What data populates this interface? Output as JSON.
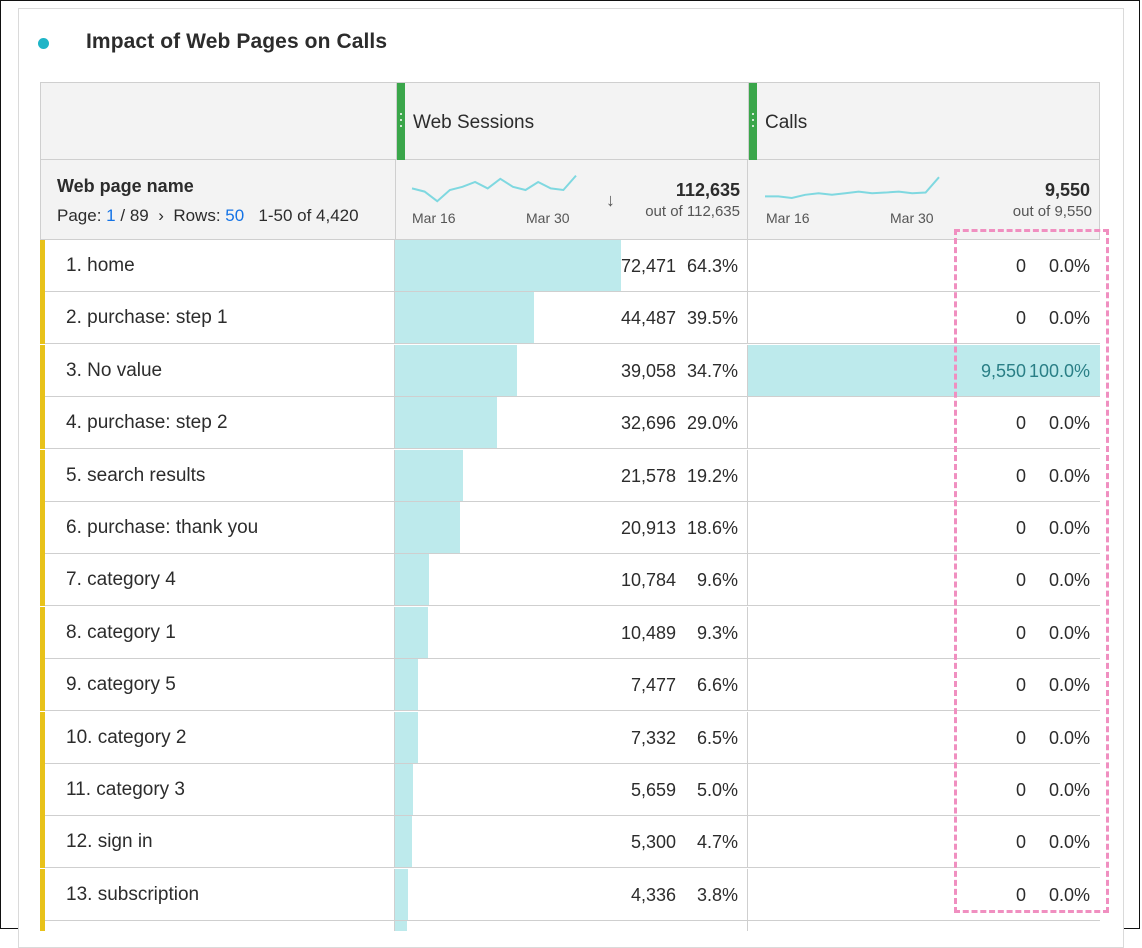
{
  "title": "Impact of Web Pages on Calls",
  "columns": [
    {
      "label": "Web Sessions"
    },
    {
      "label": "Calls"
    }
  ],
  "dimension": {
    "name": "Web page name",
    "page_label": "Page:",
    "page_current": "1",
    "page_total": "/ 89",
    "next_glyph": "›",
    "rows_label": "Rows:",
    "rows_value": "50",
    "range": "1-50 of 4,420"
  },
  "metrics": [
    {
      "sort_glyph": "↓",
      "total": "112,635",
      "out_of": "out of 112,635",
      "date_start": "Mar 16",
      "date_end": "Mar 30",
      "trend": [
        0.55,
        0.45,
        0.15,
        0.5,
        0.6,
        0.75,
        0.55,
        0.85,
        0.6,
        0.5,
        0.75,
        0.55,
        0.5,
        0.95
      ]
    },
    {
      "sort_glyph": "",
      "total": "9,550",
      "out_of": "out of 9,550",
      "date_start": "Mar 16",
      "date_end": "Mar 30",
      "trend": [
        0.3,
        0.3,
        0.25,
        0.35,
        0.4,
        0.35,
        0.4,
        0.45,
        0.4,
        0.42,
        0.45,
        0.4,
        0.42,
        0.9
      ]
    }
  ],
  "colors": {
    "accent": "#1fb5c7",
    "column_marker": "#3aa64a",
    "row_marker": "#e8c21a",
    "bar": "#bdeaec",
    "highlight": "#f08fc0"
  },
  "rows": [
    {
      "name": "1. home",
      "ws": "72,471",
      "ws_pct": "64.3%",
      "ws_frac": 0.643,
      "calls": "0",
      "calls_pct": "0.0%",
      "calls_frac": 0
    },
    {
      "name": "2. purchase: step 1",
      "ws": "44,487",
      "ws_pct": "39.5%",
      "ws_frac": 0.395,
      "calls": "0",
      "calls_pct": "0.0%",
      "calls_frac": 0
    },
    {
      "name": "3. No value",
      "ws": "39,058",
      "ws_pct": "34.7%",
      "ws_frac": 0.347,
      "calls": "9,550",
      "calls_pct": "100.0%",
      "calls_frac": 1.0
    },
    {
      "name": "4. purchase: step 2",
      "ws": "32,696",
      "ws_pct": "29.0%",
      "ws_frac": 0.29,
      "calls": "0",
      "calls_pct": "0.0%",
      "calls_frac": 0
    },
    {
      "name": "5. search results",
      "ws": "21,578",
      "ws_pct": "19.2%",
      "ws_frac": 0.192,
      "calls": "0",
      "calls_pct": "0.0%",
      "calls_frac": 0
    },
    {
      "name": "6. purchase: thank you",
      "ws": "20,913",
      "ws_pct": "18.6%",
      "ws_frac": 0.186,
      "calls": "0",
      "calls_pct": "0.0%",
      "calls_frac": 0
    },
    {
      "name": "7. category 4",
      "ws": "10,784",
      "ws_pct": "9.6%",
      "ws_frac": 0.096,
      "calls": "0",
      "calls_pct": "0.0%",
      "calls_frac": 0
    },
    {
      "name": "8. category 1",
      "ws": "10,489",
      "ws_pct": "9.3%",
      "ws_frac": 0.093,
      "calls": "0",
      "calls_pct": "0.0%",
      "calls_frac": 0
    },
    {
      "name": "9. category 5",
      "ws": "7,477",
      "ws_pct": "6.6%",
      "ws_frac": 0.066,
      "calls": "0",
      "calls_pct": "0.0%",
      "calls_frac": 0
    },
    {
      "name": "10. category 2",
      "ws": "7,332",
      "ws_pct": "6.5%",
      "ws_frac": 0.065,
      "calls": "0",
      "calls_pct": "0.0%",
      "calls_frac": 0
    },
    {
      "name": "11. category 3",
      "ws": "5,659",
      "ws_pct": "5.0%",
      "ws_frac": 0.05,
      "calls": "0",
      "calls_pct": "0.0%",
      "calls_frac": 0
    },
    {
      "name": "12. sign in",
      "ws": "5,300",
      "ws_pct": "4.7%",
      "ws_frac": 0.047,
      "calls": "0",
      "calls_pct": "0.0%",
      "calls_frac": 0
    },
    {
      "name": "13. subscription",
      "ws": "4,336",
      "ws_pct": "3.8%",
      "ws_frac": 0.038,
      "calls": "0",
      "calls_pct": "0.0%",
      "calls_frac": 0
    },
    {
      "name": "",
      "ws": "",
      "ws_pct": "",
      "ws_frac": 0.035,
      "calls": "",
      "calls_pct": "",
      "calls_frac": 0
    }
  ]
}
